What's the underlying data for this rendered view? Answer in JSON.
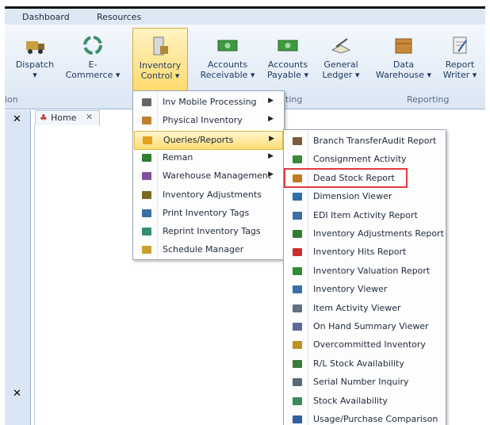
{
  "tabs": [
    "Dashboard",
    "Resources"
  ],
  "ribbon": {
    "buttons": [
      {
        "label1": "Dispatch",
        "label2": "▾",
        "icon": "truck-icon"
      },
      {
        "label1": "E-",
        "label2": "Commerce ▾",
        "icon": "recycle-icon"
      },
      {
        "label1": "Inventory",
        "label2": "Control ▾",
        "icon": "inventory-icon"
      },
      {
        "label1": "Accounts",
        "label2": "Receivable ▾",
        "icon": "money-icon"
      },
      {
        "label1": "Accounts",
        "label2": "Payable ▾",
        "icon": "money-icon"
      },
      {
        "label1": "General",
        "label2": "Ledger ▾",
        "icon": "ledger-icon"
      },
      {
        "label1": "Data",
        "label2": "Warehouse ▾",
        "icon": "warehouse-icon"
      },
      {
        "label1": "Report",
        "label2": "Writer ▾",
        "icon": "report-icon"
      }
    ],
    "group_labels": [
      "ion",
      "ting",
      "Reporting"
    ]
  },
  "doc_tab": "Home",
  "inventory_menu": [
    {
      "label": "Inv Mobile Processing",
      "submenu": true
    },
    {
      "label": "Physical Inventory",
      "submenu": true
    },
    {
      "label": "Queries/Reports",
      "submenu": true
    },
    {
      "label": "Reman",
      "submenu": true
    },
    {
      "label": "Warehouse Management",
      "submenu": true
    },
    {
      "label": "Inventory Adjustments",
      "submenu": false
    },
    {
      "label": "Print Inventory Tags",
      "submenu": false
    },
    {
      "label": "Reprint Inventory Tags",
      "submenu": false
    },
    {
      "label": "Schedule Manager",
      "submenu": false
    }
  ],
  "reports_menu": [
    "Branch TransferAudit Report",
    "Consignment Activity",
    "Dead Stock Report",
    "Dimension Viewer",
    "EDI Item Activity Report",
    "Inventory Adjustments Report",
    "Inventory Hits Report",
    "Inventory Valuation Report",
    "Inventory Viewer",
    "Item Activity Viewer",
    "On Hand Summary Viewer",
    "Overcommitted Inventory",
    "R/L Stock Availability",
    "Serial Number Inquiry",
    "Stock Availability",
    "Usage/Purchase Comparison"
  ],
  "colors": {
    "highlight": "#ffd966",
    "callout": "#e0393e"
  }
}
